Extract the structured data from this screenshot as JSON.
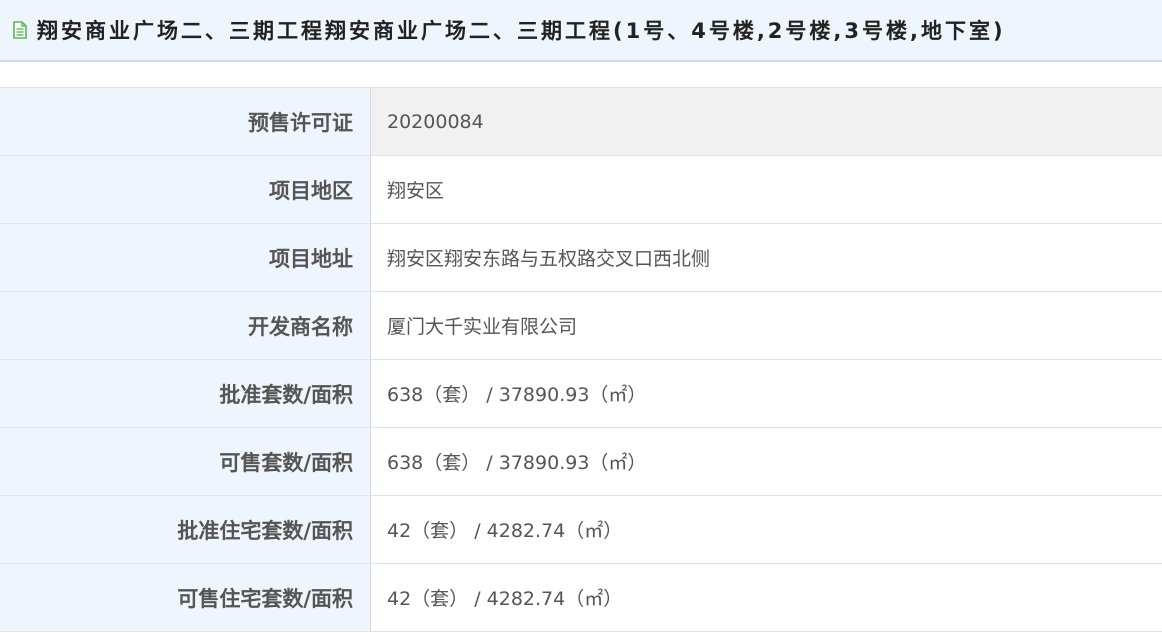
{
  "header": {
    "icon": "document-icon",
    "icon_color": "#5cb85c",
    "title": "翔安商业广场二、三期工程翔安商业广场二、三期工程(1号、4号楼,2号楼,3号楼,地下室)"
  },
  "rows": [
    {
      "label": "预售许可证",
      "value": "20200084"
    },
    {
      "label": "项目地区",
      "value": "翔安区"
    },
    {
      "label": "项目地址",
      "value": "翔安区翔安东路与五权路交叉口西北侧"
    },
    {
      "label": "开发商名称",
      "value": "厦门大千实业有限公司"
    },
    {
      "label": "批准套数/面积",
      "value": "638（套） / 37890.93（㎡）"
    },
    {
      "label": "可售套数/面积",
      "value": "638（套） / 37890.93（㎡）"
    },
    {
      "label": "批准住宅套数/面积",
      "value": "42（套） / 4282.74（㎡）"
    },
    {
      "label": "可售住宅套数/面积",
      "value": "42（套） / 4282.74（㎡）"
    }
  ]
}
